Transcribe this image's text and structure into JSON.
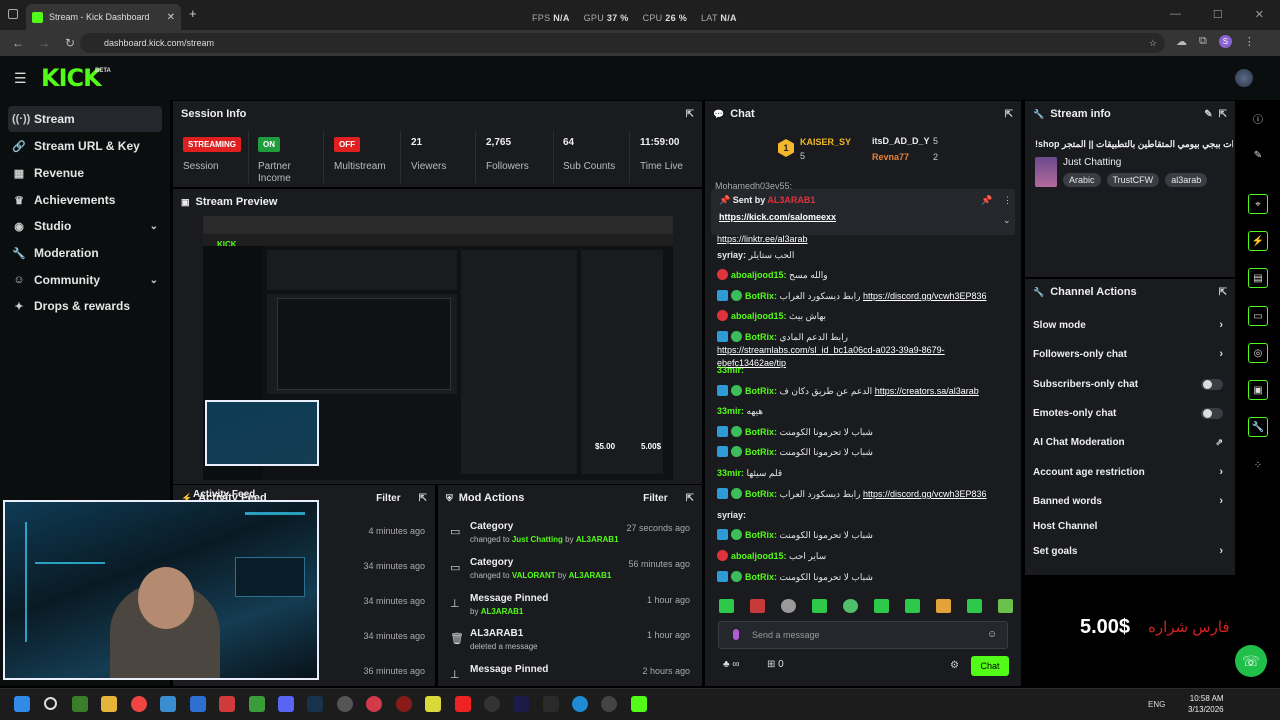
{
  "browser": {
    "tab_title": "Stream - Kick Dashboard",
    "url": "dashboard.kick.com/stream",
    "perf": [
      {
        "label": "FPS",
        "value": "N/A"
      },
      {
        "label": "GPU",
        "value": "37 %"
      },
      {
        "label": "CPU",
        "value": "26 %"
      },
      {
        "label": "LAT",
        "value": "N/A"
      }
    ]
  },
  "brand": {
    "logo": "KICK",
    "beta": "BETA",
    "accent": "#53fc18"
  },
  "sidebar": {
    "items": [
      {
        "label": "Stream",
        "icon": "signal-icon"
      },
      {
        "label": "Stream URL & Key",
        "icon": "link-icon"
      },
      {
        "label": "Revenue",
        "icon": "bar-chart-icon"
      },
      {
        "label": "Achievements",
        "icon": "trophy-icon"
      },
      {
        "label": "Studio",
        "icon": "camera-icon"
      },
      {
        "label": "Moderation",
        "icon": "wrench-icon"
      },
      {
        "label": "Community",
        "icon": "users-icon"
      },
      {
        "label": "Drops & rewards",
        "icon": "gift-icon"
      }
    ]
  },
  "session": {
    "title": "Session Info",
    "streaming_badge": "STREAMING",
    "streaming_label": "Session",
    "partner_badge": "ON",
    "partner_label": "Partner Income",
    "multistream_badge": "OFF",
    "multistream_label": "Multistream",
    "viewers": "21",
    "viewers_label": "Viewers",
    "followers": "2,765",
    "followers_label": "Followers",
    "subs": "64",
    "subs_label": "Sub Counts",
    "time": "11:59:00",
    "time_label": "Time Live"
  },
  "preview": {
    "title": "Stream Preview",
    "mini_amount": "$5.00",
    "mini_amount2": "5.00$"
  },
  "activity": {
    "title": "Activity Feed",
    "filter": "Filter",
    "times": [
      "4 minutes ago",
      "34 minutes ago",
      "34 minutes ago",
      "34 minutes ago",
      "36 minutes ago"
    ]
  },
  "mod": {
    "title": "Mod Actions",
    "filter": "Filter",
    "rows": [
      {
        "title": "Category",
        "sub_pre": "changed to",
        "sub_hl": "Just Chatting",
        "sub_mid": "by",
        "sub_user": "AL3ARAB1",
        "time": "27 seconds ago",
        "icon": "category-icon"
      },
      {
        "title": "Category",
        "sub_pre": "changed to",
        "sub_hl": "VALORANT",
        "sub_mid": "by",
        "sub_user": "AL3ARAB1",
        "time": "56 minutes ago",
        "icon": "category-icon"
      },
      {
        "title": "Message Pinned",
        "sub_pre": "by",
        "sub_hl": "AL3ARAB1",
        "sub_mid": "",
        "sub_user": "",
        "time": "1 hour ago",
        "icon": "pin-icon"
      },
      {
        "title": "AL3ARAB1",
        "sub_pre": "deleted a message",
        "sub_hl": "",
        "sub_mid": "",
        "sub_user": "",
        "time": "1 hour ago",
        "icon": "trash-icon"
      },
      {
        "title": "Message Pinned",
        "sub_pre": "",
        "sub_hl": "",
        "sub_mid": "",
        "sub_user": "",
        "time": "2 hours ago",
        "icon": "pin-icon"
      }
    ]
  },
  "chat": {
    "title": "Chat",
    "top": [
      {
        "rank": "1",
        "name": "KAISER_SY",
        "count": "5"
      },
      {
        "name": "itsD_AD_D_Y",
        "count": "5"
      },
      {
        "name": "Revna77",
        "count": "2"
      }
    ],
    "pinned_by_label": "Sent by",
    "pinned_by": "AL3ARAB1",
    "pinned_link": "https://kick.com/salomeexx",
    "cut_top": "Mohamedh03ev55:",
    "cut_link": "https://linktr.ee/al3arab",
    "messages": [
      {
        "user": "syriay:",
        "text": "الحب ستايلر",
        "type": "plain",
        "color": "#e8e8e8"
      },
      {
        "user": "aboaljood15:",
        "text": "والله مسح",
        "type": "red",
        "color": "#53fc18"
      },
      {
        "user": "BotRix:",
        "text": "رابط ديسكورد العراب",
        "link": "https://discord.gg/vcwh3EP836",
        "type": "bot",
        "color": "#53fc18"
      },
      {
        "user": "aboaljood15:",
        "text": "بهاش بيث",
        "type": "red",
        "color": "#53fc18"
      },
      {
        "user": "BotRix:",
        "text": "رابط الدعم المادي",
        "link": "https://streamlabs.com/sl_id_bc1a06cd-a023-39a9-8679-ebefc13462ae/tip",
        "type": "bot",
        "color": "#53fc18"
      },
      {
        "user": "33mir:",
        "text": "",
        "type": "plain",
        "color": "#53fc18"
      },
      {
        "user": "BotRix:",
        "text": "الدعم عن طريق دكان ف",
        "link": "https://creators.sa/al3arab",
        "type": "bot",
        "color": "#53fc18"
      },
      {
        "user": "33mir:",
        "text": "هيهه",
        "type": "plain",
        "color": "#53fc18"
      },
      {
        "user": "BotRix:",
        "text": "شباب لا تحرمونا الكومنت",
        "type": "bot",
        "color": "#53fc18"
      },
      {
        "user": "BotRix:",
        "text": "شباب لا تحرمونا الكومنت",
        "type": "bot",
        "color": "#53fc18"
      },
      {
        "user": "33mir:",
        "text": "قلم سيئها",
        "type": "plain",
        "color": "#53fc18"
      },
      {
        "user": "BotRix:",
        "text": "رابط ديسكورد العراب",
        "link": "https://discord.gg/vcwh3EP836",
        "type": "bot",
        "color": "#53fc18"
      },
      {
        "user": "syriay:",
        "text": "",
        "type": "plain",
        "color": "#e8e8e8"
      },
      {
        "user": "BotRix:",
        "text": "شباب لا تحرمونا الكومنت",
        "type": "bot",
        "color": "#53fc18"
      },
      {
        "user": "aboaljood15:",
        "text": "ساير احب",
        "type": "red",
        "color": "#53fc18"
      },
      {
        "user": "BotRix:",
        "text": "شباب لا تحرمونا الكومنت",
        "type": "bot",
        "color": "#53fc18"
      }
    ],
    "placeholder": "Send a message",
    "infinity": "∞",
    "gifts": "0",
    "send": "Chat"
  },
  "stream_info": {
    "title": "Stream info",
    "stream_title": "!shop شحن شدات ببجي بيومي المتقاطين بالتطبيقات || المتجر",
    "category": "Just Chatting",
    "tags": [
      "Arabic",
      "TrustCFW",
      "al3arab"
    ]
  },
  "channel_actions": {
    "title": "Channel Actions",
    "items": [
      {
        "label": "Slow mode",
        "control": "chevron"
      },
      {
        "label": "Followers-only chat",
        "control": "chevron"
      },
      {
        "label": "Subscribers-only chat",
        "control": "toggle"
      },
      {
        "label": "Emotes-only chat",
        "control": "toggle"
      },
      {
        "label": "AI Chat Moderation",
        "control": "external"
      },
      {
        "label": "Account age restriction",
        "control": "chevron"
      },
      {
        "label": "Banned words",
        "control": "chevron"
      },
      {
        "label": "Host Channel",
        "control": "none"
      },
      {
        "label": "Set goals",
        "control": "chevron"
      }
    ]
  },
  "overlay": {
    "amount": "5.00$",
    "arabic": "فارس شراره"
  },
  "taskbar": {
    "lang": "ENG",
    "time": "10:58 AM",
    "date": "3/13/2026"
  }
}
